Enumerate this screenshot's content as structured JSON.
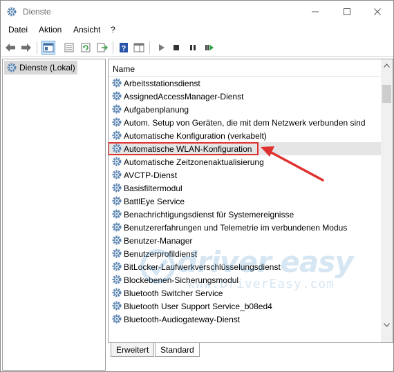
{
  "window": {
    "title": "Dienste"
  },
  "menu": {
    "items": [
      "Datei",
      "Aktion",
      "Ansicht",
      "?"
    ]
  },
  "tree": {
    "root_label": "Dienste (Lokal)"
  },
  "list": {
    "column_name": "Name",
    "rows": [
      "Arbeitsstationsdienst",
      "AssignedAccessManager-Dienst",
      "Aufgabenplanung",
      "Autom. Setup von Geräten, die mit dem Netzwerk verbunden sind",
      "Automatische Konfiguration (verkabelt)",
      "Automatische WLAN-Konfiguration",
      "Automatische Zeitzonenaktualisierung",
      "AVCTP-Dienst",
      "Basisfiltermodul",
      "BattlEye Service",
      "Benachrichtigungsdienst für Systemereignisse",
      "Benutzererfahrungen und Telemetrie im verbundenen Modus",
      "Benutzer-Manager",
      "Benutzerprofildienst",
      "BitLocker-Laufwerkverschlüsselungsdienst",
      "Blockebenen-Sicherungsmodul",
      "Bluetooth Switcher Service",
      "Bluetooth User Support Service_b08ed4",
      "Bluetooth-Audiogateway-Dienst"
    ],
    "selected_index": 5
  },
  "tabs": {
    "extended": "Erweitert",
    "standard": "Standard"
  },
  "watermark": {
    "brand": "driver easy",
    "url": "www.DriverEasy.com"
  },
  "colors": {
    "annotation": "#e03131",
    "gear": "#4a7fb5",
    "selection": "#e5e5e5"
  }
}
